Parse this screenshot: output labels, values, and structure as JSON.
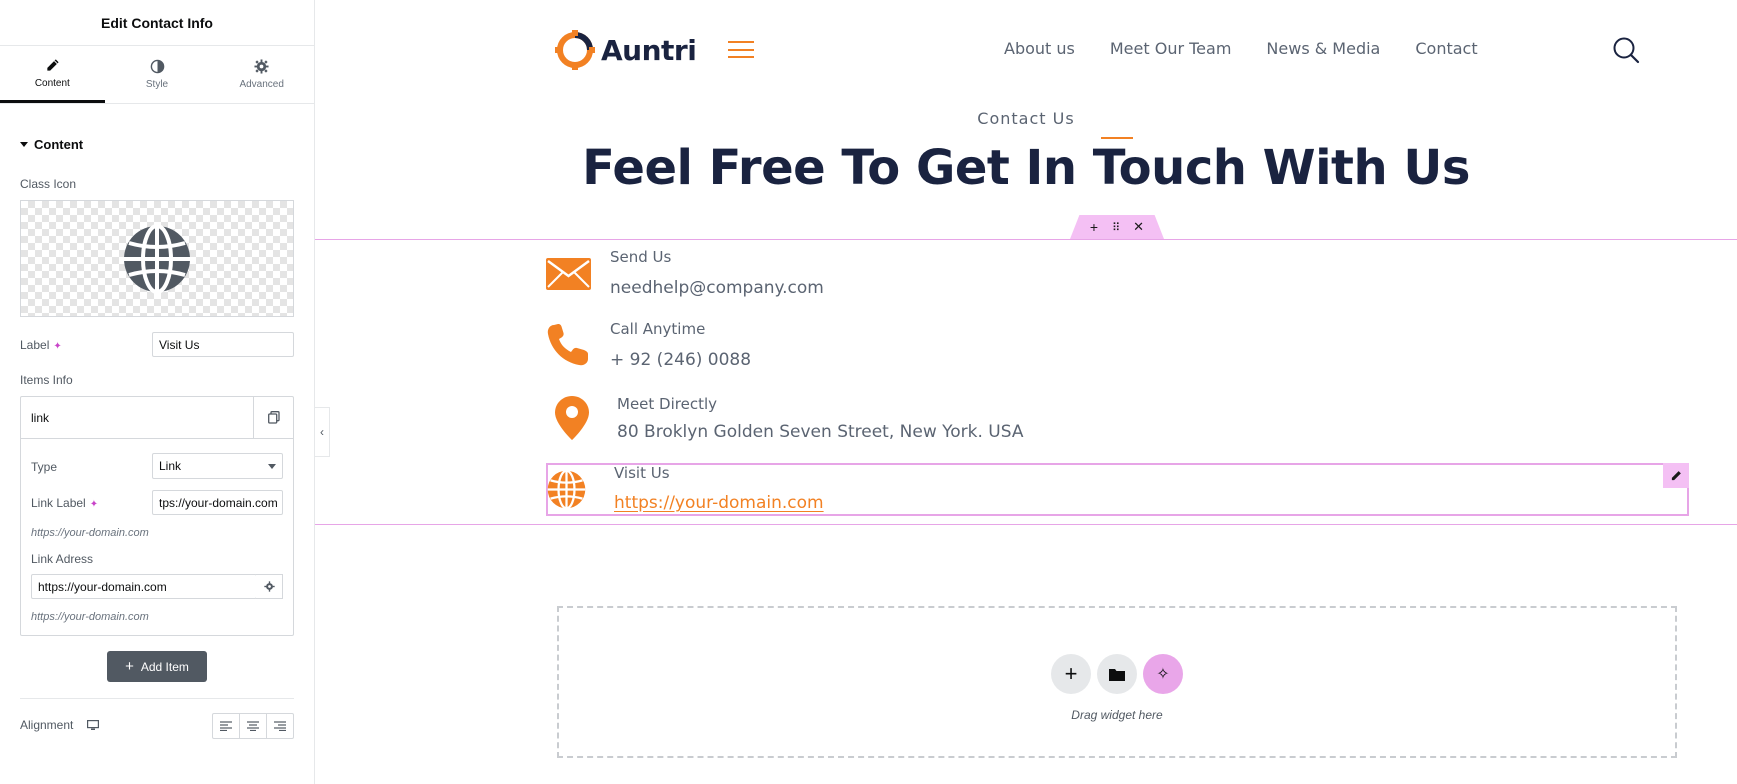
{
  "panel": {
    "title": "Edit Contact Info",
    "tabs": [
      {
        "label": "Content",
        "icon": "pencil-icon"
      },
      {
        "label": "Style",
        "icon": "half-circle-icon"
      },
      {
        "label": "Advanced",
        "icon": "gear-icon"
      }
    ],
    "section_title": "Content",
    "class_icon_label": "Class Icon",
    "label_label": "Label",
    "label_value": "Visit Us",
    "items_info_label": "Items Info",
    "repeater": {
      "item_title": "link",
      "type_label": "Type",
      "type_value": "Link",
      "link_label_label": "Link Label",
      "link_label_value": "tps://your-domain.com",
      "link_label_hint": "https://your-domain.com",
      "link_address_label": "Link Adress",
      "link_address_value": "https://your-domain.com",
      "link_address_hint": "https://your-domain.com"
    },
    "add_item_label": "Add Item",
    "alignment_label": "Alignment"
  },
  "site": {
    "logo_text": "Auntri",
    "nav": [
      "About us",
      "Meet Our Team",
      "News & Media",
      "Contact"
    ],
    "eyebrow": "Contact Us",
    "headline": "Feel Free To Get In Touch With Us",
    "contacts": [
      {
        "label": "Send Us",
        "value": "needhelp@company.com",
        "icon": "envelope-icon"
      },
      {
        "label": "Call Anytime",
        "value": "+ 92 (246) 0088",
        "icon": "phone-icon"
      },
      {
        "label": "Meet Directly",
        "value": "80 Broklyn Golden Seven Street, New York. USA",
        "icon": "location-pin-icon"
      },
      {
        "label": "Visit Us",
        "value": "https://your-domain.com",
        "icon": "globe-icon"
      }
    ],
    "dropzone_text": "Drag widget here"
  },
  "colors": {
    "accent": "#f28123",
    "navy": "#1a2340",
    "editor_highlight": "#e7a5e7"
  }
}
